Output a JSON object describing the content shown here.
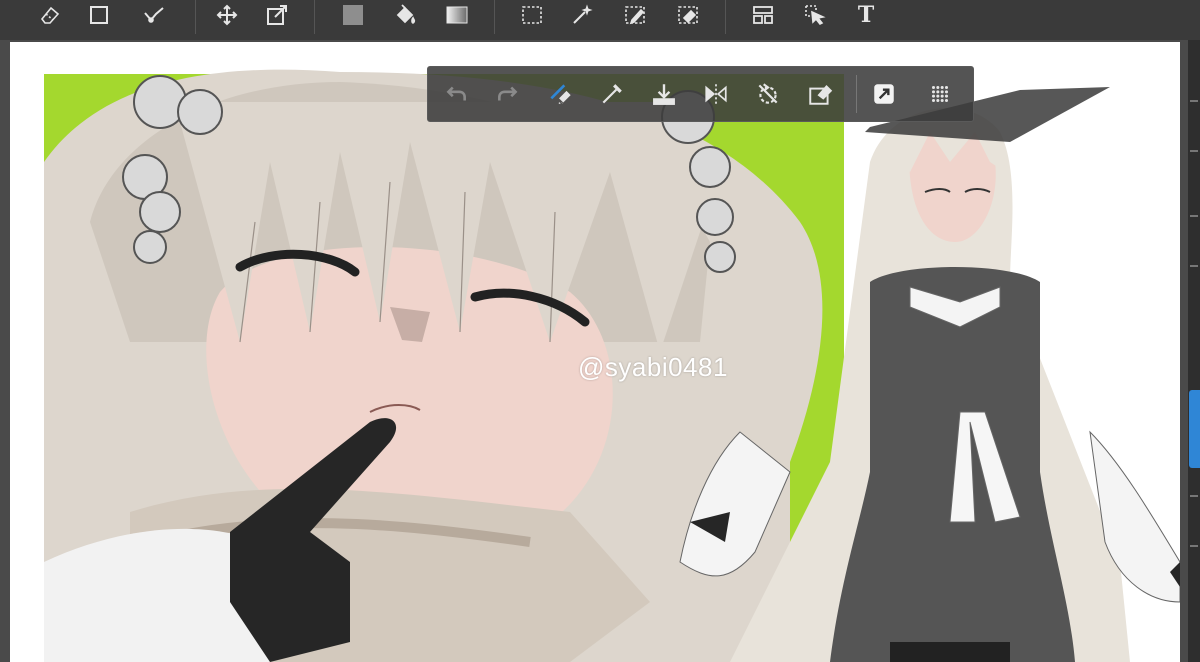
{
  "toolbar": {
    "tools": [
      {
        "name": "eraser-tool-icon"
      },
      {
        "name": "rectangle-tool-icon"
      },
      {
        "name": "correct-line-tool-icon"
      },
      {
        "name": "move-tool-icon"
      },
      {
        "name": "transform-tool-icon"
      },
      {
        "name": "color-swatch-icon"
      },
      {
        "name": "bucket-fill-icon"
      },
      {
        "name": "gradient-icon"
      },
      {
        "name": "selection-rect-icon"
      },
      {
        "name": "magic-wand-icon"
      },
      {
        "name": "selection-pen-icon"
      },
      {
        "name": "selection-eraser-icon"
      },
      {
        "name": "frame-divider-icon"
      },
      {
        "name": "operation-tool-icon"
      }
    ],
    "text_tool_label": "T"
  },
  "floating_bar": {
    "buttons": [
      {
        "name": "undo-icon"
      },
      {
        "name": "redo-icon"
      },
      {
        "name": "brush-eraser-toggle-icon"
      },
      {
        "name": "eyedropper-icon"
      },
      {
        "name": "save-download-icon"
      },
      {
        "name": "flip-horizontal-icon"
      },
      {
        "name": "rotate-reset-icon"
      },
      {
        "name": "clear-layer-icon"
      },
      {
        "name": "transform-arrow-icon"
      },
      {
        "name": "grid-menu-icon"
      }
    ]
  },
  "canvas": {
    "watermark": "@syabi0481",
    "colors": {
      "background_green": "#a4d82e",
      "hair": "#ddd6cd",
      "skin": "#f0d4cc",
      "glove": "#262626",
      "dress": "#555555"
    }
  },
  "theme": {
    "toolbar_bg": "#3a3a3a",
    "icon_color": "#e6e6e6",
    "accent_blue": "#2f86d6"
  }
}
